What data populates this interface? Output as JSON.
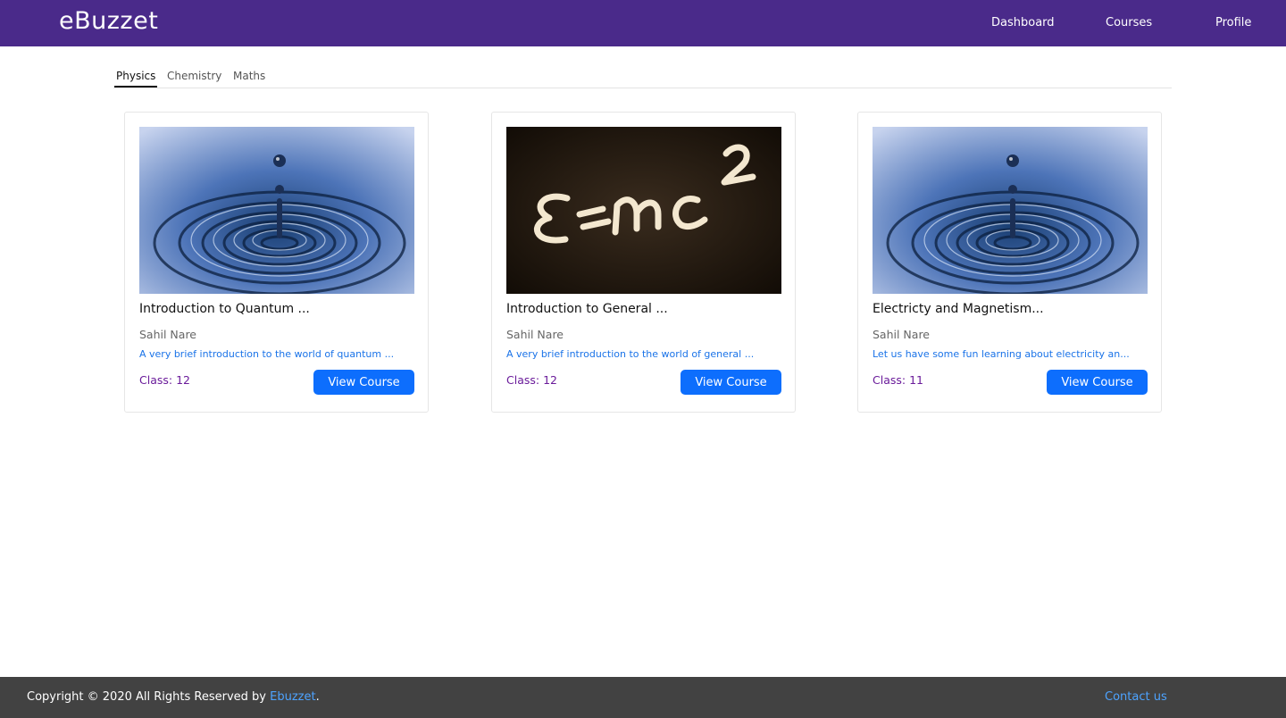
{
  "navbar": {
    "brand": "eBuzzet",
    "links": [
      "Dashboard",
      "Courses",
      "Profile"
    ],
    "bg_color": "#4a2a8a"
  },
  "tabs": [
    {
      "label": "Physics",
      "active": true
    },
    {
      "label": "Chemistry",
      "active": false
    },
    {
      "label": "Maths",
      "active": false
    }
  ],
  "courses": [
    {
      "title": "Introduction to Quantum ...",
      "author": "Sahil Nare",
      "description": "A very brief introduction to the world of quantum ...",
      "class_label": "Class: 12",
      "button": "View Course",
      "image": "water-drop-ripple"
    },
    {
      "title": "Introduction to General ...",
      "author": "Sahil Nare",
      "description": "A very brief introduction to the world of general ...",
      "class_label": "Class: 12",
      "button": "View Course",
      "image": "emc2-chalkboard"
    },
    {
      "title": "Electricty and Magnetism...",
      "author": "Sahil Nare",
      "description": "Let us have some fun learning about electricity an...",
      "class_label": "Class: 11",
      "button": "View Course",
      "image": "water-drop-ripple"
    }
  ],
  "footer": {
    "copyright_prefix": "Copyright © 2020 All Rights Reserved by",
    "brand": "Ebuzzet",
    "suffix": ".",
    "contact": "Contact us"
  },
  "colors": {
    "button": "#0d6efd",
    "link": "#1a73e8",
    "class_text": "#6a1b9a",
    "footer_bg": "#424242"
  }
}
